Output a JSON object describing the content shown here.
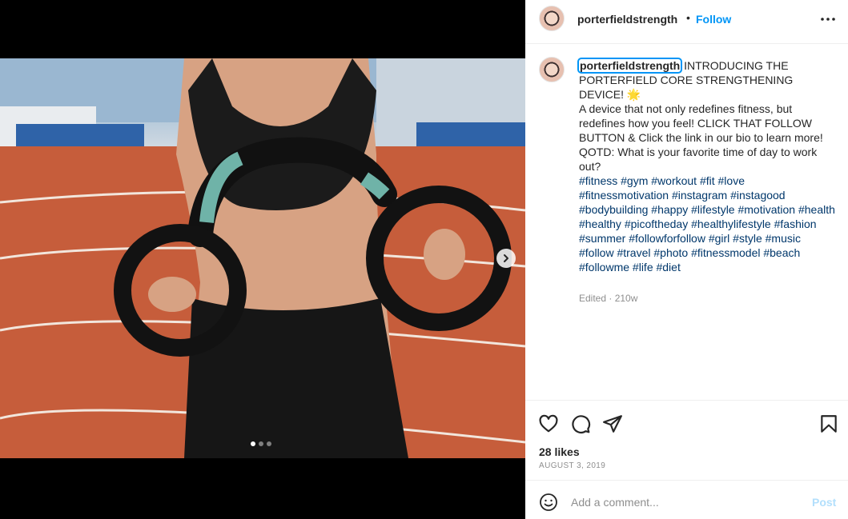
{
  "post": {
    "username": "porterfieldstrength",
    "separator": "•",
    "follow_label": "Follow",
    "more_icon": "more-horizontal-icon",
    "caption": {
      "username": "porterfieldstrength",
      "text": " INTRODUCING THE PORTERFIELD CORE STRENGTHENING DEVICE! 🌟\nA device that not only redefines fitness, but redefines how you feel! CLICK THAT FOLLOW BUTTON & Click the link in our bio to learn more!\nQOTD: What is your favorite time of day to work out?",
      "hashtags": "#fitness #gym #workout #fit #love #fitnessmotivation #instagram #instagood #bodybuilding #happy #lifestyle #motivation #health #healthy #picoftheday #healthylifestyle #fashion #summer #followforfollow #girl #style #music #follow #travel #photo #fitnessmodel #beach #followme #life #diet"
    },
    "meta": "Edited · 210w",
    "likes": "28 likes",
    "date": "AUGUST 3, 2019",
    "carousel": {
      "current": 1,
      "total": 3
    }
  },
  "comment": {
    "placeholder": "Add a comment...",
    "post_label": "Post"
  },
  "colors": {
    "link": "#0095f6",
    "hashtag": "#00376b",
    "muted": "#8e8e8e",
    "text": "#262626"
  }
}
